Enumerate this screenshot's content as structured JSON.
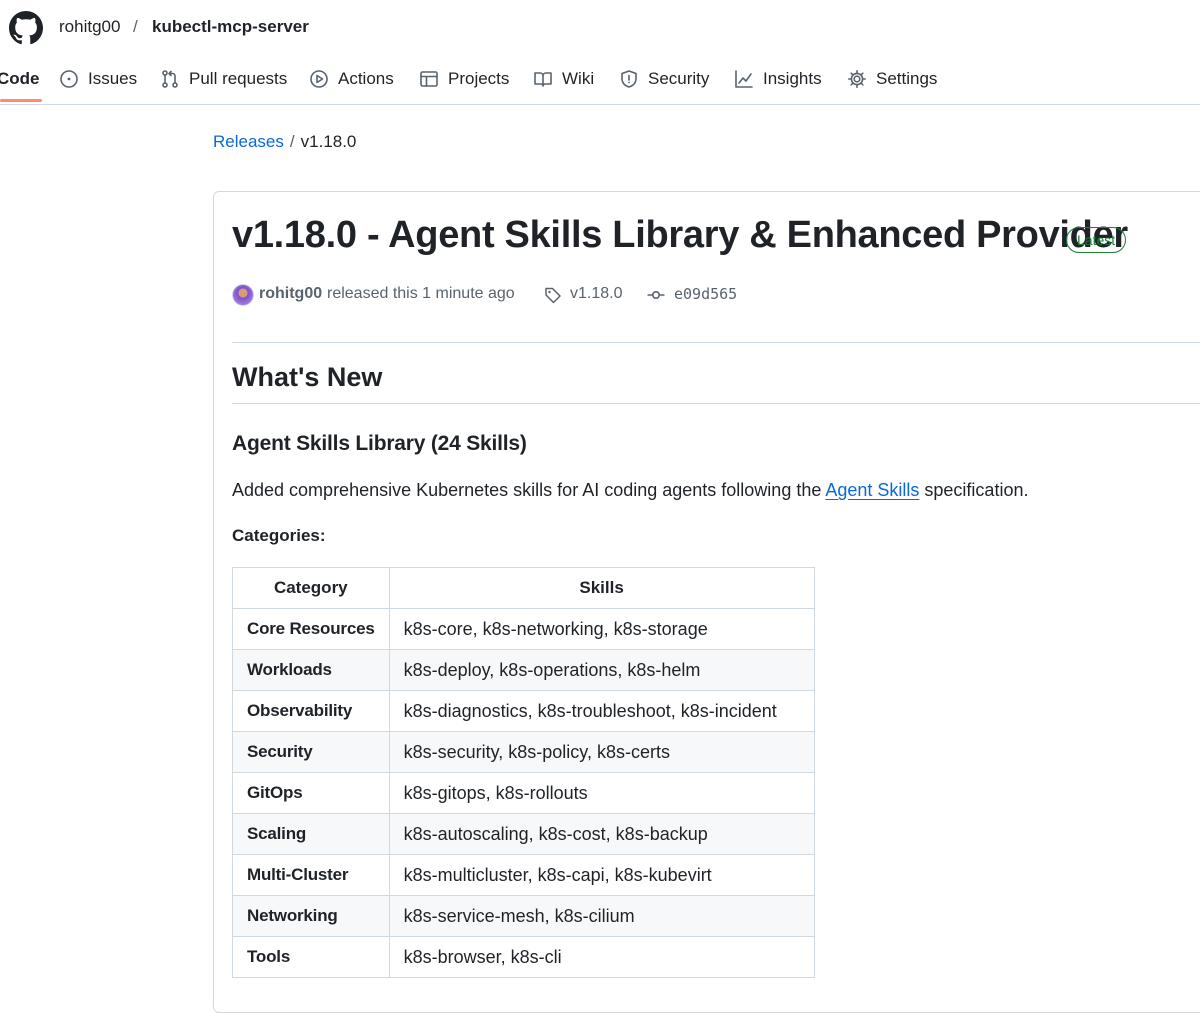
{
  "repo": {
    "owner": "rohitg00",
    "separator": "/",
    "name": "kubectl-mcp-server"
  },
  "nav": {
    "tabs": [
      {
        "label": "Code",
        "icon": "code-icon",
        "selected": true
      },
      {
        "label": "Issues",
        "icon": "issue-opened-icon"
      },
      {
        "label": "Pull requests",
        "icon": "git-pull-request-icon"
      },
      {
        "label": "Actions",
        "icon": "play-icon"
      },
      {
        "label": "Projects",
        "icon": "table-icon"
      },
      {
        "label": "Wiki",
        "icon": "book-icon"
      },
      {
        "label": "Security",
        "icon": "shield-icon"
      },
      {
        "label": "Insights",
        "icon": "graph-icon"
      },
      {
        "label": "Settings",
        "icon": "gear-icon"
      }
    ],
    "selected_color": "#fd8c73"
  },
  "breadcrumb": {
    "link": "Releases",
    "separator": "/",
    "current": "v1.18.0"
  },
  "release": {
    "title": "v1.18.0 - Agent Skills Library & Enhanced Provider",
    "badge": "Latest",
    "author": "rohitg00",
    "released_text": "released this 1 minute ago",
    "tag": "v1.18.0",
    "commit": "e09d565"
  },
  "body": {
    "h2": "What's New",
    "h3": "Agent Skills Library (24 Skills)",
    "para_before": "Added comprehensive Kubernetes skills for AI coding agents following the ",
    "para_link": "Agent Skills",
    "para_after": " specification.",
    "categories_label": "Categories:"
  },
  "table": {
    "headers": [
      "Category",
      "Skills"
    ],
    "rows": [
      [
        "Core Resources",
        "k8s-core, k8s-networking, k8s-storage"
      ],
      [
        "Workloads",
        "k8s-deploy, k8s-operations, k8s-helm"
      ],
      [
        "Observability",
        "k8s-diagnostics, k8s-troubleshoot, k8s-incident"
      ],
      [
        "Security",
        "k8s-security, k8s-policy, k8s-certs"
      ],
      [
        "GitOps",
        "k8s-gitops, k8s-rollouts"
      ],
      [
        "Scaling",
        "k8s-autoscaling, k8s-cost, k8s-backup"
      ],
      [
        "Multi-Cluster",
        "k8s-multicluster, k8s-capi, k8s-kubevirt"
      ],
      [
        "Networking",
        "k8s-service-mesh, k8s-cilium"
      ],
      [
        "Tools",
        "k8s-browser, k8s-cli"
      ]
    ]
  },
  "colors": {
    "link": "#0969da",
    "latest_badge": "#1a7f37",
    "border": "#d1d9e0",
    "muted": "#59636e"
  }
}
